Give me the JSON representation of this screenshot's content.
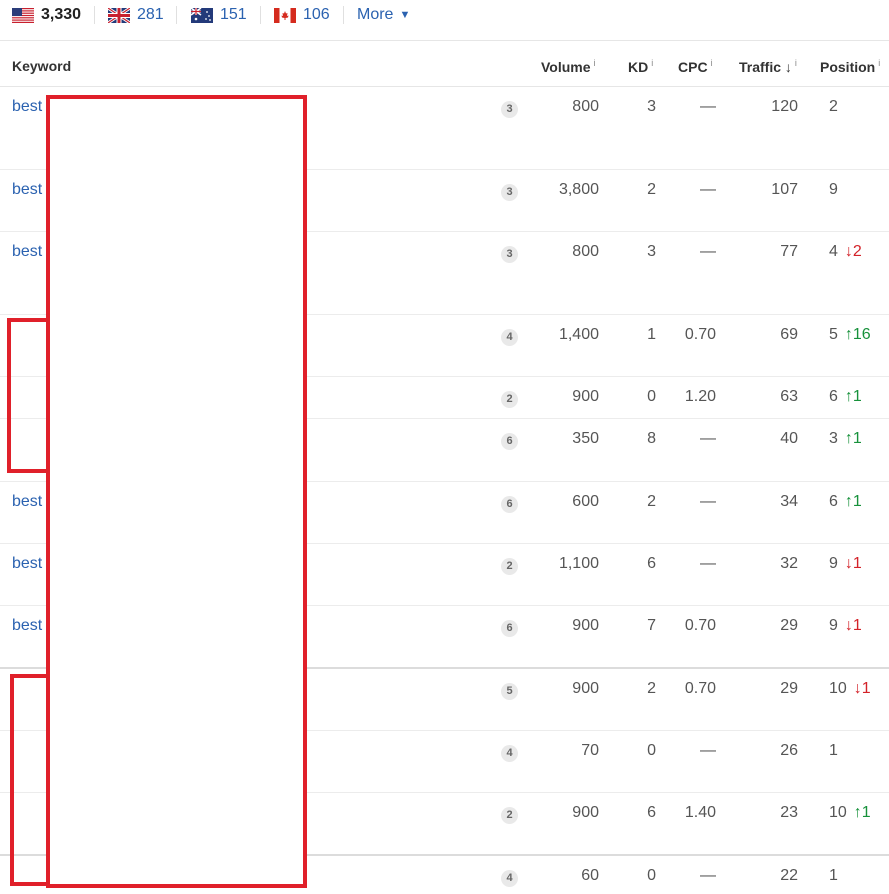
{
  "countries": [
    {
      "flag": "us-flag-icon",
      "count": "3,330"
    },
    {
      "flag": "uk-flag-icon",
      "count": "281"
    },
    {
      "flag": "au-flag-icon",
      "count": "151"
    },
    {
      "flag": "ca-flag-icon",
      "count": "106"
    }
  ],
  "more_label": "More",
  "headers": {
    "keyword": "Keyword",
    "volume": "Volume",
    "kd": "KD",
    "cpc": "CPC",
    "traffic": "Traffic",
    "position": "Position",
    "info_mark": "i",
    "sort_arrow": "↓"
  },
  "rows": [
    {
      "keyword": "best",
      "serp": "3",
      "volume": "800",
      "kd": "3",
      "cpc": "—",
      "traffic": "120",
      "position": "2",
      "delta": "",
      "dir": ""
    },
    {
      "keyword": "best",
      "serp": "3",
      "volume": "3,800",
      "kd": "2",
      "cpc": "—",
      "traffic": "107",
      "position": "9",
      "delta": "",
      "dir": ""
    },
    {
      "keyword": "best",
      "serp": "3",
      "volume": "800",
      "kd": "3",
      "cpc": "—",
      "traffic": "77",
      "position": "4",
      "delta": "↓2",
      "dir": "down"
    },
    {
      "keyword": "",
      "serp": "4",
      "volume": "1,400",
      "kd": "1",
      "cpc": "0.70",
      "traffic": "69",
      "position": "5",
      "delta": "↑16",
      "dir": "up"
    },
    {
      "keyword": "",
      "serp": "2",
      "volume": "900",
      "kd": "0",
      "cpc": "1.20",
      "traffic": "63",
      "position": "6",
      "delta": "↑1",
      "dir": "up"
    },
    {
      "keyword": "",
      "serp": "6",
      "volume": "350",
      "kd": "8",
      "cpc": "—",
      "traffic": "40",
      "position": "3",
      "delta": "↑1",
      "dir": "up"
    },
    {
      "keyword": "best",
      "serp": "6",
      "volume": "600",
      "kd": "2",
      "cpc": "—",
      "traffic": "34",
      "position": "6",
      "delta": "↑1",
      "dir": "up"
    },
    {
      "keyword": "best",
      "serp": "2",
      "volume": "1,100",
      "kd": "6",
      "cpc": "—",
      "traffic": "32",
      "position": "9",
      "delta": "↓1",
      "dir": "down"
    },
    {
      "keyword": "best",
      "serp": "6",
      "volume": "900",
      "kd": "7",
      "cpc": "0.70",
      "traffic": "29",
      "position": "9",
      "delta": "↓1",
      "dir": "down"
    },
    {
      "keyword": "",
      "serp": "5",
      "volume": "900",
      "kd": "2",
      "cpc": "0.70",
      "traffic": "29",
      "position": "10",
      "delta": "↓1",
      "dir": "down"
    },
    {
      "keyword": "",
      "serp": "4",
      "volume": "70",
      "kd": "0",
      "cpc": "—",
      "traffic": "26",
      "position": "1",
      "delta": "",
      "dir": ""
    },
    {
      "keyword": "",
      "serp": "2",
      "volume": "900",
      "kd": "6",
      "cpc": "1.40",
      "traffic": "23",
      "position": "10",
      "delta": "↑1",
      "dir": "up"
    },
    {
      "keyword": "",
      "serp": "4",
      "volume": "60",
      "kd": "0",
      "cpc": "—",
      "traffic": "22",
      "position": "1",
      "delta": "",
      "dir": ""
    }
  ],
  "colors": {
    "link": "#2b62b0",
    "up": "#17913b",
    "down": "#d32229",
    "redaction": "#e0202a"
  }
}
